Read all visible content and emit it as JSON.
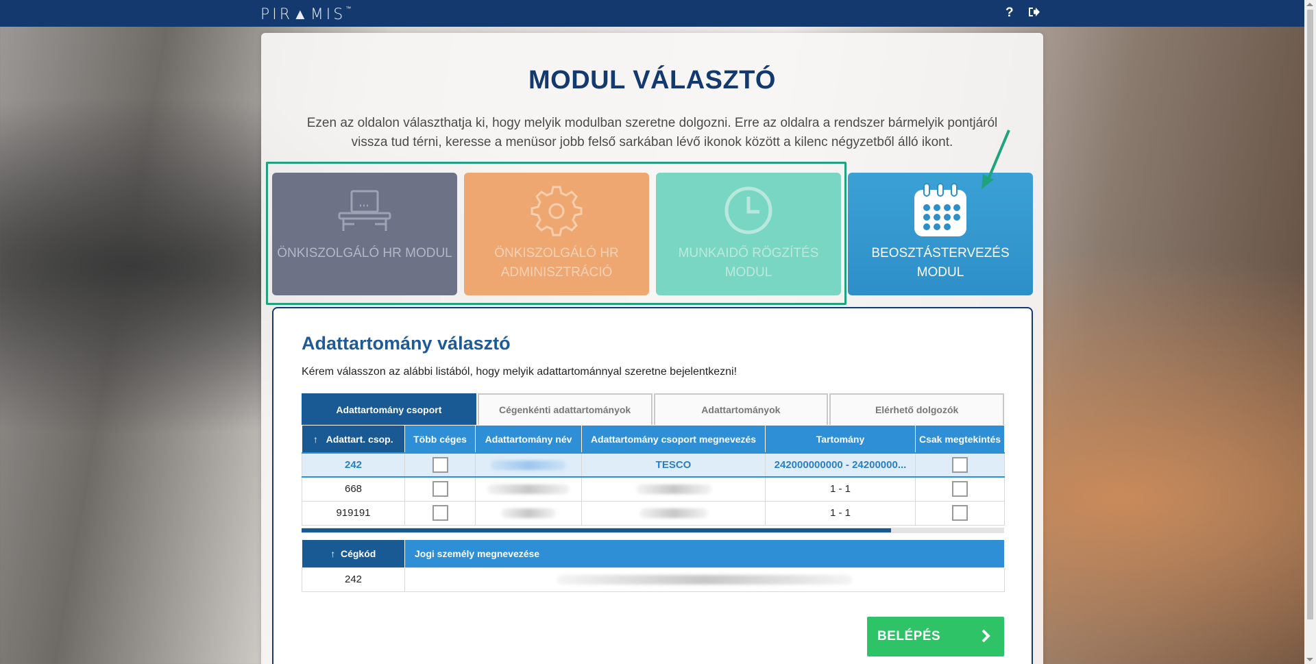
{
  "topbar": {
    "logo_text": "PIR▲MIS",
    "logo_tm": "™",
    "help_icon": "?",
    "logout_icon": "sign-out-icon"
  },
  "page": {
    "title": "MODUL VÁLASZTÓ",
    "intro": "Ezen az oldalon választhatja ki, hogy melyik modulban szeretne dolgozni. Erre az oldalra a rendszer bármelyik pontjáról vissza tud térni, keresse a menüsor jobb felső sarkában lévő ikonok között a kilenc négyzetből álló ikont."
  },
  "modules": [
    {
      "label": "ÖNKISZOLGÁLÓ HR MODUL",
      "icon": "desk-icon",
      "color": "#6e7287"
    },
    {
      "label": "ÖNKISZOLGÁLÓ HR ADMINISZTRÁCIÓ",
      "icon": "gear-icon",
      "color": "#efa772"
    },
    {
      "label": "MUNKAIDŐ RÖGZÍTÉS MODUL",
      "icon": "clock-icon",
      "color": "#79d6c2"
    },
    {
      "label": "BEOSZTÁSTERVEZÉS MODUL",
      "icon": "calendar-icon",
      "color": "#3ba1d5"
    }
  ],
  "domain": {
    "title": "Adattartomány választó",
    "subtitle": "Kérem válasszon az alábbi listából, hogy melyik adattartománnyal szeretne bejelentkezni!",
    "tabs": [
      "Adattartomány csoport",
      "Cégenkénti adattartományok",
      "Adattartományok",
      "Elérhető dolgozók"
    ],
    "grid1": {
      "sort_icon": "↑",
      "headers": [
        "Adattart. csop.",
        "Több céges",
        "Adattartomány név",
        "Adattartomány csoport megnevezés",
        "Tartomány",
        "Csak megtekintés"
      ],
      "rows": [
        {
          "code": "242",
          "group_name": "TESCO",
          "range": "242000000000 - 24200000..."
        },
        {
          "code": "668",
          "group_name": "",
          "range": "1 - 1"
        },
        {
          "code": "919191",
          "group_name": "",
          "range": "1 - 1"
        }
      ]
    },
    "grid2": {
      "sort_icon": "↑",
      "headers": [
        "Cégkód",
        "Jogi személy megnevezése"
      ],
      "rows": [
        {
          "code": "242"
        }
      ]
    },
    "login_label": "BELÉPÉS"
  },
  "colors": {
    "navy": "#14396e",
    "accent_blue": "#2e8fd6",
    "green": "#2ec366",
    "teal_frame": "#1ea37e"
  }
}
